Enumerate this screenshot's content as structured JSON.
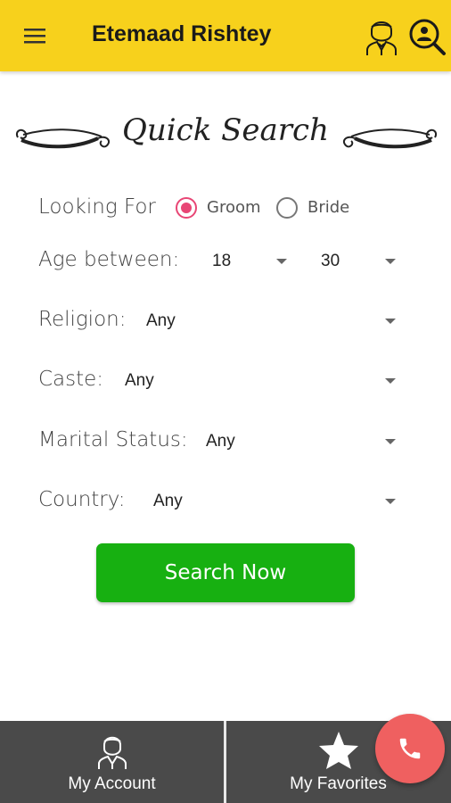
{
  "app": {
    "title": "Etemaad Rishtey"
  },
  "colors": {
    "appbar": "#f7d11c",
    "accent_radio": "#e84675",
    "search_button": "#17b011",
    "bottom_bar": "#4a4a4a",
    "fab": "#ef6060"
  },
  "icons": {
    "menu": "hamburger-menu-icon",
    "profile": "user-profile-icon",
    "search_profile": "search-profile-icon",
    "account": "user-avatar-icon",
    "favorites": "star-icon",
    "call": "phone-icon"
  },
  "quick_search": {
    "heading": "Quick Search",
    "looking_for": {
      "label": "Looking For",
      "options": [
        "Groom",
        "Bride"
      ],
      "selected": "Groom"
    },
    "age": {
      "label": "Age between:",
      "min": "18",
      "max": "30"
    },
    "religion": {
      "label": "Religion:",
      "value": "Any"
    },
    "caste": {
      "label": "Caste:",
      "value": "Any"
    },
    "marital_status": {
      "label": "Marital Status:",
      "value": "Any"
    },
    "country": {
      "label": "Country:",
      "value": "Any"
    },
    "submit_label": "Search Now"
  },
  "bottom_nav": {
    "account_label": "My Account",
    "favorites_label": "My Favorites"
  }
}
